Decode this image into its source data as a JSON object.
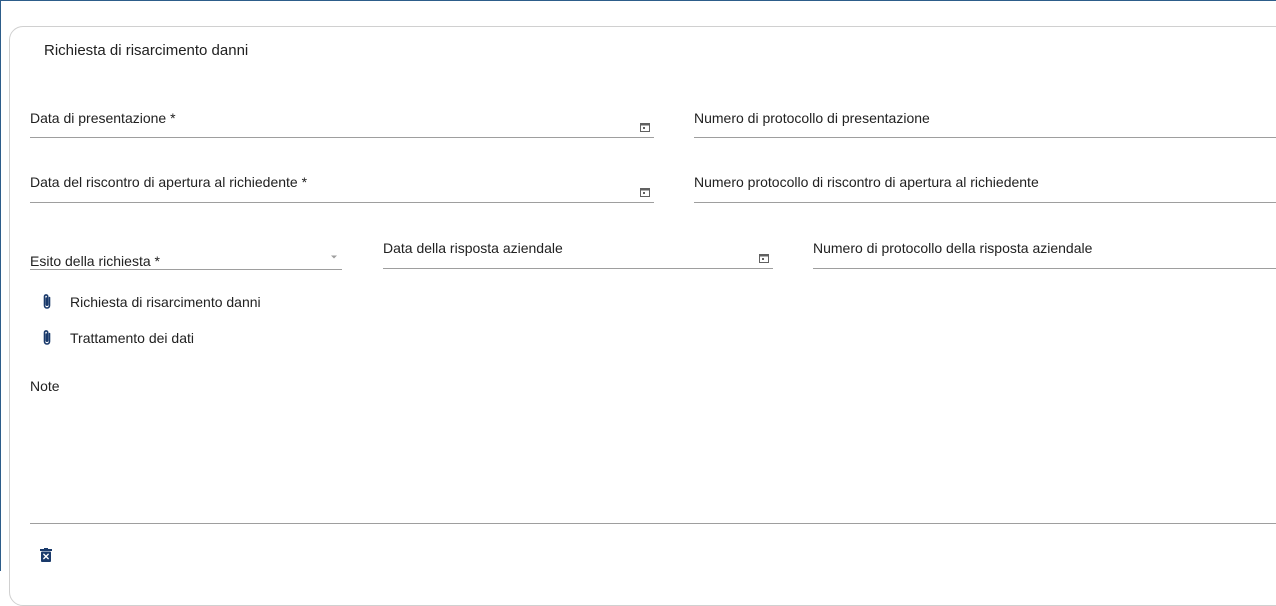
{
  "card": {
    "title": "Richiesta di risarcimento danni"
  },
  "fields": {
    "data_presentazione": {
      "label": "Data di presentazione *",
      "icon": "calendar-icon"
    },
    "numero_protocollo_presentazione": {
      "label": "Numero di protocollo di presentazione"
    },
    "data_riscontro": {
      "label": "Data del riscontro di apertura al richiedente *",
      "icon": "calendar-icon"
    },
    "numero_protocollo_riscontro": {
      "label": "Numero protocollo di riscontro di apertura al richiedente"
    },
    "esito_richiesta": {
      "label": "Esito della richiesta *",
      "icon": "dropdown-arrow-icon"
    },
    "data_risposta": {
      "label": "Data della risposta aziendale",
      "icon": "calendar-icon"
    },
    "numero_protocollo_risposta": {
      "label": "Numero di protocollo della risposta aziendale"
    }
  },
  "attachments": [
    {
      "label": "Richiesta di risarcimento danni",
      "icon": "paperclip-icon"
    },
    {
      "label": "Trattamento dei dati",
      "icon": "paperclip-icon"
    }
  ],
  "note": {
    "label": "Note",
    "value": ""
  },
  "actions": {
    "delete_icon": "trash-icon"
  },
  "colors": {
    "accent": "#1a3a6b",
    "border": "#2d5d8a",
    "underline": "#9e9e9e",
    "text": "#212121"
  }
}
